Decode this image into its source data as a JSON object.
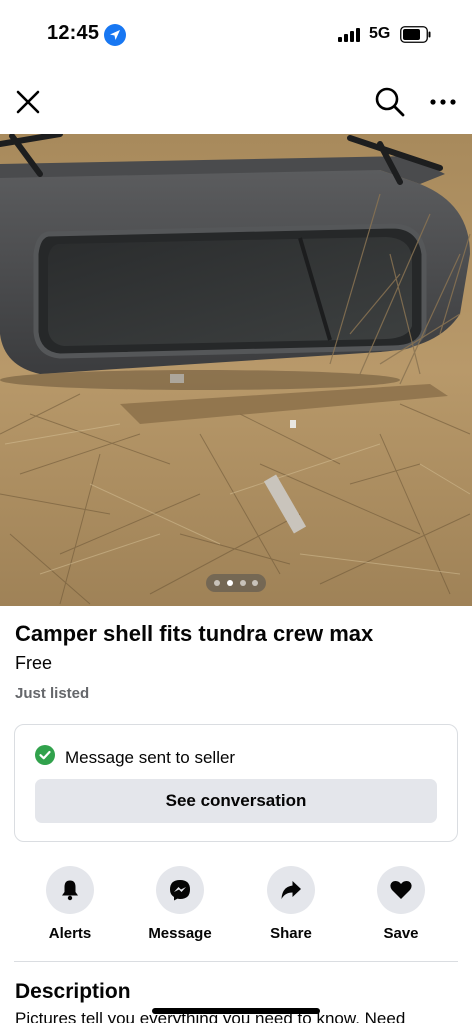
{
  "status_bar": {
    "time": "12:45",
    "network": "5G"
  },
  "nav": {
    "close_icon": "close-icon",
    "search_icon": "search-icon",
    "more_icon": "more-icon"
  },
  "photo": {
    "subject": "camper-shell-photo",
    "page_count": 4,
    "active_page": 2
  },
  "listing": {
    "title": "Camper shell fits tundra crew max",
    "price": "Free",
    "listed": "Just listed"
  },
  "message_card": {
    "status": "Message sent to seller",
    "button": "See conversation",
    "status_color": "#31a24c"
  },
  "actions": [
    {
      "label": "Alerts",
      "icon": "bell-icon"
    },
    {
      "label": "Message",
      "icon": "messenger-icon"
    },
    {
      "label": "Share",
      "icon": "share-arrow-icon"
    },
    {
      "label": "Save",
      "icon": "heart-icon"
    }
  ],
  "description": {
    "heading": "Description",
    "text": "Pictures tell you everything you need to know. Need"
  }
}
